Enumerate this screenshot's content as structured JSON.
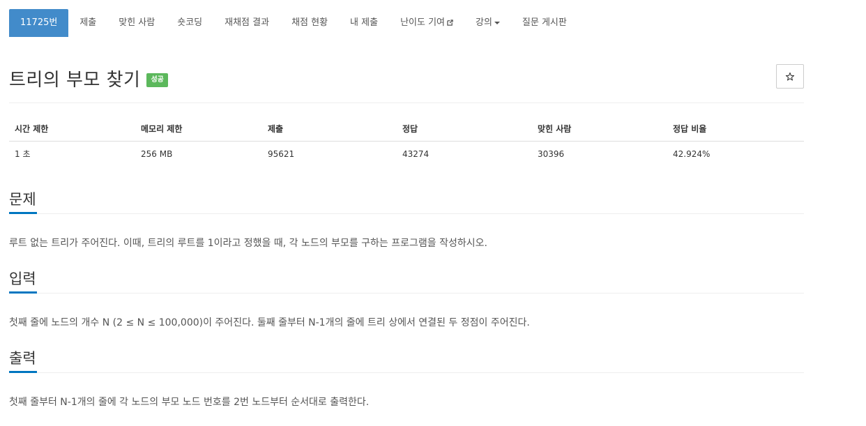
{
  "nav": {
    "items": [
      {
        "label": "11725번"
      },
      {
        "label": "제출"
      },
      {
        "label": "맞힌 사람"
      },
      {
        "label": "숏코딩"
      },
      {
        "label": "재채점 결과"
      },
      {
        "label": "채점 현황"
      },
      {
        "label": "내 제출"
      },
      {
        "label": "난이도 기여"
      },
      {
        "label": "강의"
      },
      {
        "label": "질문 게시판"
      }
    ],
    "external_icon": "external-link-icon",
    "caret_icon": "caret-down-icon"
  },
  "problem": {
    "title": "트리의 부모 찾기",
    "badge": "성공",
    "star_icon": "star-icon"
  },
  "info_table": {
    "headers": [
      "시간 제한",
      "메모리 제한",
      "제출",
      "정답",
      "맞힌 사람",
      "정답 비율"
    ],
    "values": [
      "1 초",
      "256 MB",
      "95621",
      "43274",
      "30396",
      "42.924%"
    ]
  },
  "sections": {
    "description": {
      "title": "문제",
      "text": "루트 없는 트리가 주어진다. 이때, 트리의 루트를 1이라고 정했을 때, 각 노드의 부모를 구하는 프로그램을 작성하시오."
    },
    "input": {
      "title": "입력",
      "text": "첫째 줄에 노드의 개수 N (2 ≤ N ≤ 100,000)이 주어진다. 둘째 줄부터 N-1개의 줄에 트리 상에서 연결된 두 정점이 주어진다."
    },
    "output": {
      "title": "출력",
      "text": "첫째 줄부터 N-1개의 줄에 각 노드의 부모 노드 번호를 2번 노드부터 순서대로 출력한다."
    }
  },
  "colors": {
    "active_tab": "#428bca",
    "badge": "#5cb85c",
    "section_underline": "#0076c0"
  }
}
